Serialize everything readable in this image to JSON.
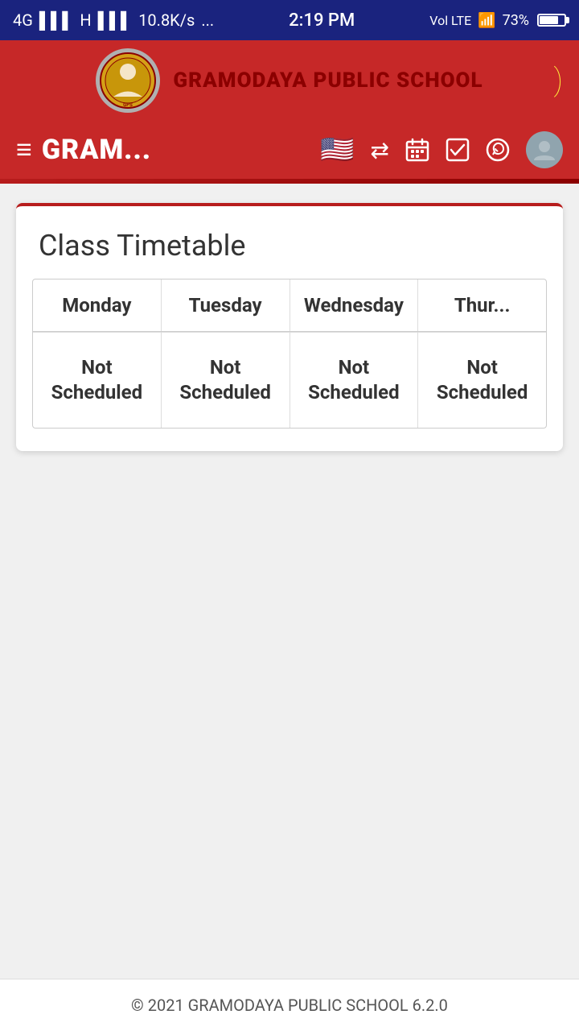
{
  "statusBar": {
    "network": "4G",
    "signal1": "H",
    "dataSpeed": "10.8K/s",
    "ellipsis": "...",
    "time": "2:19 PM",
    "volLTE": "VoLTE",
    "wifi": "WiFi",
    "battery": "73%"
  },
  "header": {
    "schoolName": "GRAMODAYA PUBLIC SCHOOL",
    "appTitle": "GRAM...",
    "spinnerIcon": ")",
    "hamburgerIcon": "≡"
  },
  "navbar": {
    "flagIcon": "🇺🇸",
    "transferIcon": "⇄",
    "calendarIcon": "📅",
    "checkboxIcon": "☑",
    "whatsappIcon": "💬",
    "avatarIcon": "👤"
  },
  "timetable": {
    "title": "Class Timetable",
    "columns": [
      "Monday",
      "Tuesday",
      "Wednesday",
      "Thur..."
    ],
    "rows": [
      [
        "Not Scheduled",
        "Not Scheduled",
        "Not Scheduled",
        "Not Scheduled"
      ]
    ]
  },
  "footer": {
    "text": "© 2021 GRAMODAYA PUBLIC SCHOOL 6.2.0"
  }
}
